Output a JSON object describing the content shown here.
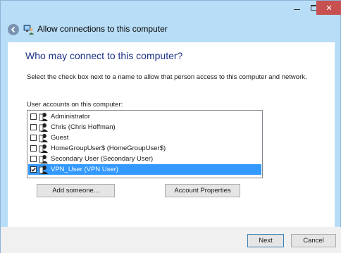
{
  "window": {
    "title": "Allow connections to this computer",
    "close_glyph": "✕"
  },
  "content": {
    "heading": "Who may connect to this computer?",
    "instructions": "Select the check box next to a name to allow that person access to this computer and network.",
    "list_label": "User accounts on this computer:",
    "users": [
      {
        "label": "Administrator",
        "checked": false,
        "selected": false
      },
      {
        "label": "Chris (Chris Hoffman)",
        "checked": false,
        "selected": false
      },
      {
        "label": "Guest",
        "checked": false,
        "selected": false
      },
      {
        "label": "HomeGroupUser$ (HomeGroupUser$)",
        "checked": false,
        "selected": false
      },
      {
        "label": "Secondary User (Secondary User)",
        "checked": false,
        "selected": false
      },
      {
        "label": "VPN_User (VPN User)",
        "checked": true,
        "selected": true
      }
    ],
    "add_button": "Add someone...",
    "properties_button": "Account Properties"
  },
  "footer": {
    "next_button": "Next",
    "cancel_button": "Cancel"
  },
  "colors": {
    "heading": "#1e3287",
    "selection": "#3399ff",
    "frame": "#b8ddf7",
    "close_button": "#c75050"
  }
}
